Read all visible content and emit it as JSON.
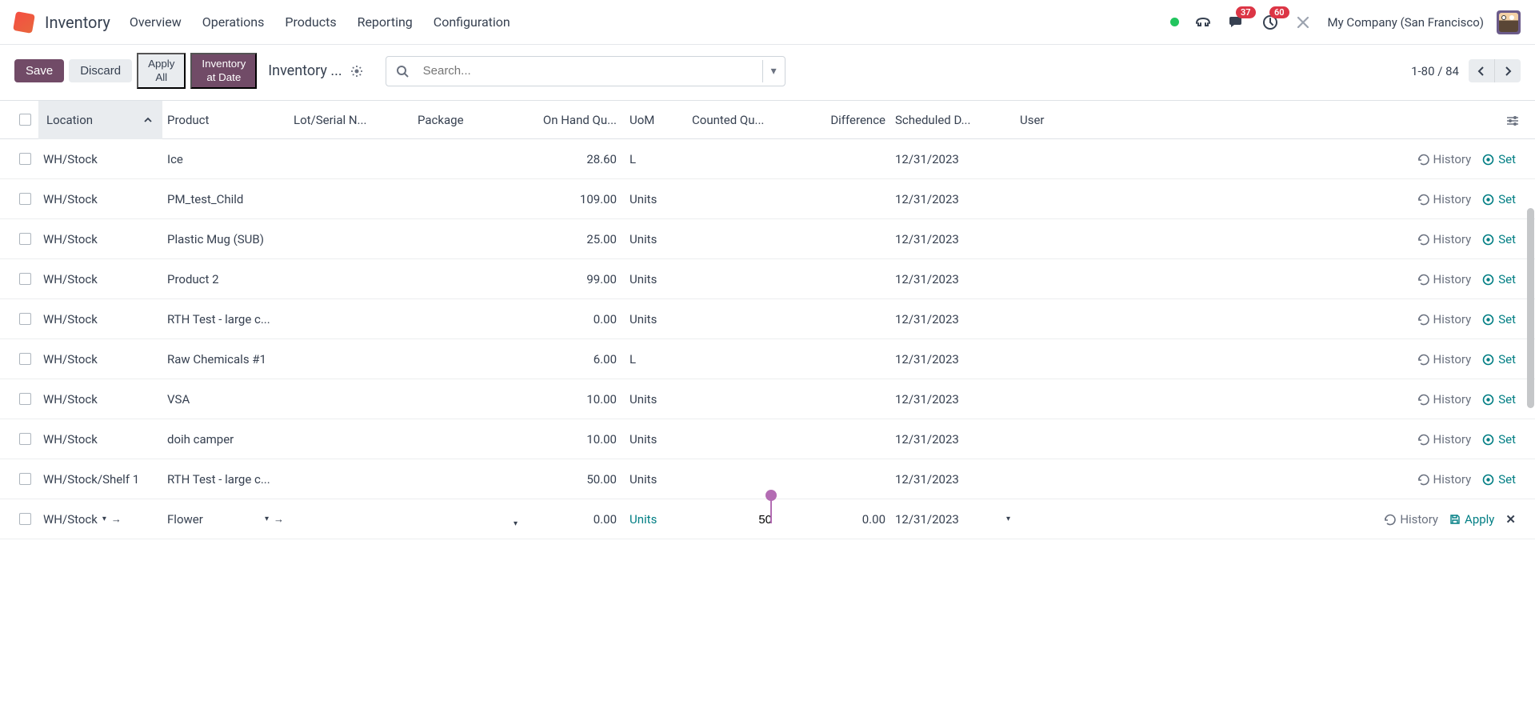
{
  "header": {
    "app": "Inventory",
    "nav": [
      "Overview",
      "Operations",
      "Products",
      "Reporting",
      "Configuration"
    ],
    "badge_msg": "37",
    "badge_activity": "60",
    "company": "My Company (San Francisco)"
  },
  "toolbar": {
    "save": "Save",
    "discard": "Discard",
    "apply_all_l1": "Apply",
    "apply_all_l2": "All",
    "inv_date_l1": "Inventory",
    "inv_date_l2": "at Date",
    "breadcrumb": "Inventory ...",
    "search_placeholder": "Search...",
    "pager": "1-80 / 84"
  },
  "columns": {
    "location": "Location",
    "product": "Product",
    "lot": "Lot/Serial N...",
    "package": "Package",
    "onhand": "On Hand Qu...",
    "uom": "UoM",
    "counted": "Counted Qu...",
    "diff": "Difference",
    "sched": "Scheduled D...",
    "user": "User"
  },
  "action_labels": {
    "history": "History",
    "set": "Set",
    "apply": "Apply"
  },
  "rows": [
    {
      "location": "WH/Stock",
      "product": "Ice",
      "onhand": "28.60",
      "uom": "L",
      "sched": "12/31/2023"
    },
    {
      "location": "WH/Stock",
      "product": "PM_test_Child",
      "onhand": "109.00",
      "uom": "Units",
      "sched": "12/31/2023"
    },
    {
      "location": "WH/Stock",
      "product": "Plastic Mug (SUB)",
      "onhand": "25.00",
      "uom": "Units",
      "sched": "12/31/2023"
    },
    {
      "location": "WH/Stock",
      "product": "Product 2",
      "onhand": "99.00",
      "uom": "Units",
      "sched": "12/31/2023"
    },
    {
      "location": "WH/Stock",
      "product": "RTH Test - large c...",
      "onhand": "0.00",
      "uom": "Units",
      "sched": "12/31/2023"
    },
    {
      "location": "WH/Stock",
      "product": "Raw Chemicals #1",
      "onhand": "6.00",
      "uom": "L",
      "sched": "12/31/2023"
    },
    {
      "location": "WH/Stock",
      "product": "VSA",
      "onhand": "10.00",
      "uom": "Units",
      "sched": "12/31/2023"
    },
    {
      "location": "WH/Stock",
      "product": "doih camper",
      "onhand": "10.00",
      "uom": "Units",
      "sched": "12/31/2023"
    },
    {
      "location": "WH/Stock/Shelf 1",
      "product": "RTH Test - large c...",
      "onhand": "50.00",
      "uom": "Units",
      "sched": "12/31/2023"
    }
  ],
  "edit_row": {
    "location": "WH/Stock",
    "product": "Flower",
    "onhand": "0.00",
    "uom": "Units",
    "counted": "50",
    "diff": "0.00",
    "sched": "12/31/2023"
  }
}
